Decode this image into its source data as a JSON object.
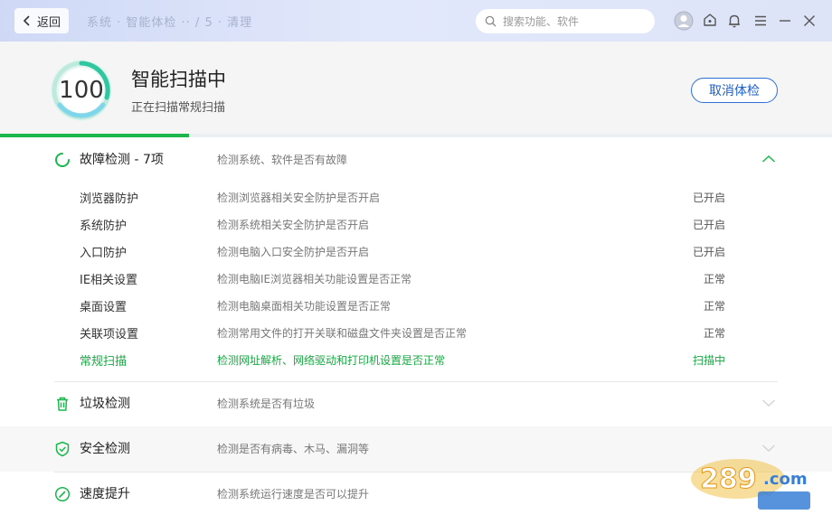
{
  "titlebar": {
    "back_label": "返回",
    "breadcrumb": "系统 · 智能体检 ·· / 5 · 清理",
    "search_placeholder": "搜索功能、软件"
  },
  "header": {
    "score": "100",
    "title": "智能扫描中",
    "subtitle": "正在扫描常规扫描",
    "cancel_label": "取消体检",
    "progress": 0.227
  },
  "sections": {
    "fault": {
      "title": "故障检测 - 7项",
      "desc": "检测系统、软件是否有故障",
      "items": [
        {
          "name": "浏览器防护",
          "desc": "检测浏览器相关安全防护是否开启",
          "status": "已开启"
        },
        {
          "name": "系统防护",
          "desc": "检测系统相关安全防护是否开启",
          "status": "已开启"
        },
        {
          "name": "入口防护",
          "desc": "检测电脑入口安全防护是否开启",
          "status": "已开启"
        },
        {
          "name": "IE相关设置",
          "desc": "检测电脑IE浏览器相关功能设置是否正常",
          "status": "正常"
        },
        {
          "name": "桌面设置",
          "desc": "检测电脑桌面相关功能设置是否正常",
          "status": "正常"
        },
        {
          "name": "关联项设置",
          "desc": "检测常用文件的打开关联和磁盘文件夹设置是否正常",
          "status": "正常"
        },
        {
          "name": "常规扫描",
          "desc": "检测网址解析、网络驱动和打印机设置是否正常",
          "status": "扫描中"
        }
      ]
    },
    "junk": {
      "title": "垃圾检测",
      "desc": "检测系统是否有垃圾"
    },
    "security": {
      "title": "安全检测",
      "desc": "检测是否有病毒、木马、漏洞等"
    },
    "speed": {
      "title": "速度提升",
      "desc": "检测系统运行速度是否可以提升"
    }
  },
  "colors": {
    "accent_green": "#1ab84c",
    "accent_blue": "#2e6fd9"
  },
  "icons": [
    "back-chevron-icon",
    "search-icon",
    "avatar-icon",
    "skin-icon",
    "bell-icon",
    "menu-icon",
    "minimize-icon",
    "close-icon",
    "loading-spinner-icon",
    "trash-icon",
    "shield-check-icon",
    "speedometer-icon",
    "chevron-up-icon",
    "chevron-down-icon"
  ]
}
